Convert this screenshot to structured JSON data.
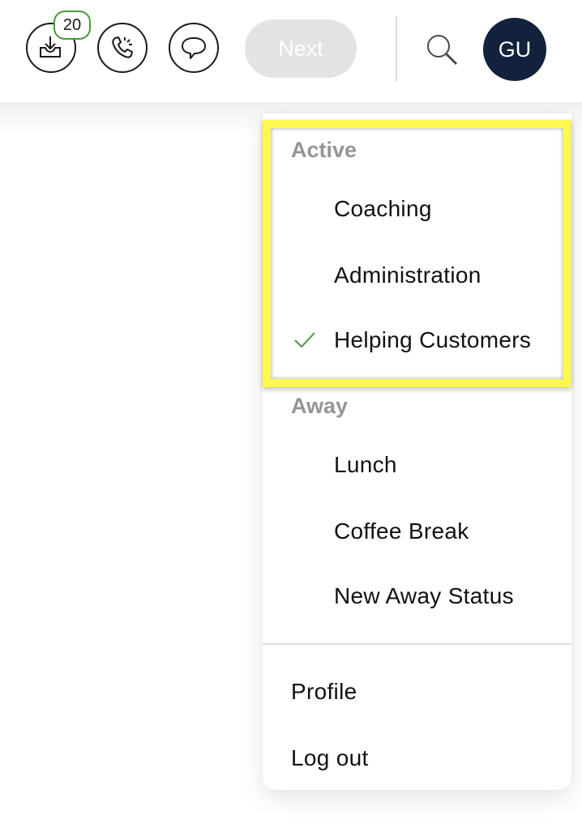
{
  "header": {
    "inbox": {
      "icon": "inbox-download-icon",
      "badge_count": "20"
    },
    "phone": {
      "icon": "phone-ringing-icon"
    },
    "chat": {
      "icon": "chat-bubble-icon"
    },
    "next_label": "Next",
    "search": {
      "icon": "search-icon"
    },
    "avatar_initials": "GU"
  },
  "status_menu": {
    "sections": [
      {
        "title": "Active",
        "items": [
          {
            "label": "Coaching",
            "selected": false
          },
          {
            "label": "Administration",
            "selected": false
          },
          {
            "label": "Helping Customers",
            "selected": true
          }
        ]
      },
      {
        "title": "Away",
        "items": [
          {
            "label": "Lunch",
            "selected": false
          },
          {
            "label": "Coffee Break",
            "selected": false
          },
          {
            "label": "New Away Status",
            "selected": false
          }
        ]
      }
    ],
    "account_items": [
      {
        "label": "Profile"
      },
      {
        "label": "Log out"
      }
    ]
  },
  "colors": {
    "avatar_bg": "#13223c",
    "badge_border": "#4a9a3a",
    "check": "#4a9a3a",
    "highlight": "#fff84e",
    "next_disabled_bg": "#e3e3e3",
    "section_title": "#959595"
  }
}
